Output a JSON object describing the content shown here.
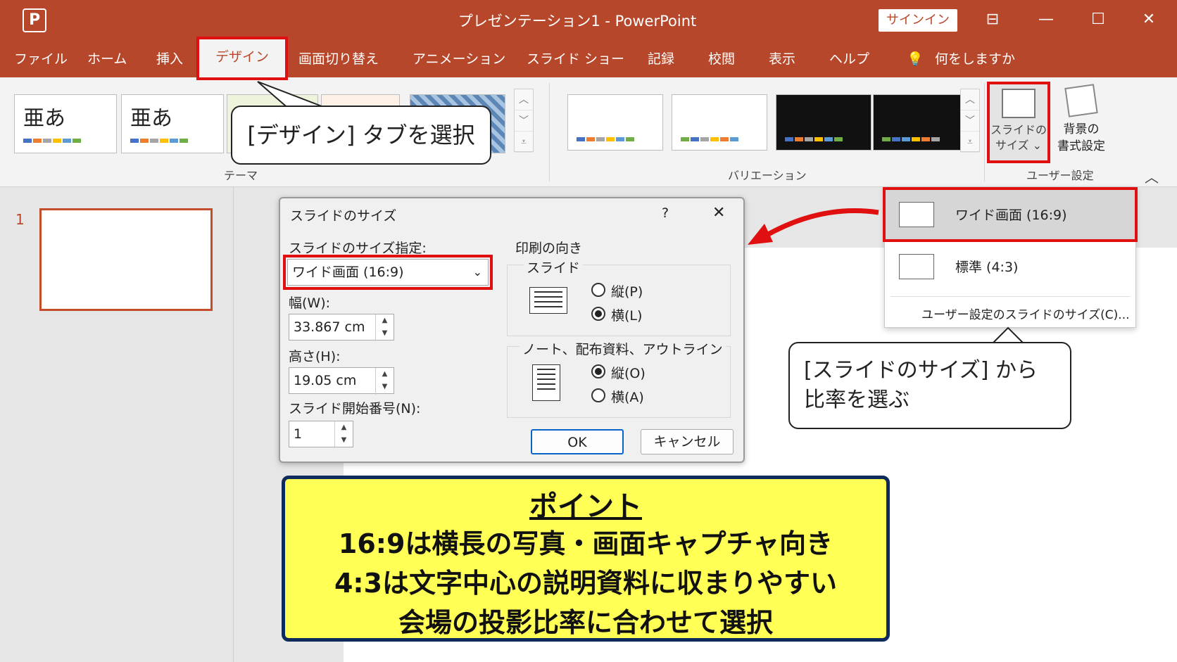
{
  "app": {
    "logo": "P",
    "title": "プレゼンテーション1 - PowerPoint",
    "signin": "サインイン"
  },
  "menu": [
    "ファイル",
    "ホーム",
    "挿入",
    "デザイン",
    "画面切り替え",
    "アニメーション",
    "スライド ショー",
    "記録",
    "校閲",
    "表示",
    "ヘルプ"
  ],
  "search_label": "何をしますか",
  "ribbon": {
    "theme_text": "亜あ",
    "themes_label": "テーマ",
    "variations_label": "バリエーション",
    "slide_size_label_1": "スライドの",
    "slide_size_label_2": "サイズ ⌄",
    "bg_format_label_1": "背景の",
    "bg_format_label_2": "書式設定",
    "user_settings_label": "ユーザー設定"
  },
  "thumbnail": {
    "number": "1"
  },
  "dialog": {
    "title": "スライドのサイズ",
    "help": "?",
    "close": "✕",
    "size_label": "スライドのサイズ指定:",
    "size_value": "ワイド画面 (16:9)",
    "width_label": "幅(W):",
    "width_value": "33.867 cm",
    "height_label": "高さ(H):",
    "height_value": "19.05 cm",
    "start_label": "スライド開始番号(N):",
    "start_value": "1",
    "orientation_label": "印刷の向き",
    "slides_label": "スライド",
    "portrait_p": "縦(P)",
    "landscape_l": "横(L)",
    "notes_label": "ノート、配布資料、アウトライン",
    "portrait_o": "縦(O)",
    "landscape_a": "横(A)",
    "ok": "OK",
    "cancel": "キャンセル"
  },
  "dropdown": {
    "wide": "ワイド画面 (16:9)",
    "standard": "標準 (4:3)",
    "custom": "ユーザー設定のスライドのサイズ(C)..."
  },
  "callouts": {
    "design_tab": "[デザイン] タブを選択",
    "size_line1": "[スライドのサイズ] から",
    "size_line2": "比率を選ぶ"
  },
  "point": {
    "title": "ポイント",
    "line1": "16:9は横長の写真・画面キャプチャ向き",
    "line2": "4:3は文字中心の説明資料に収まりやすい",
    "line3": "会場の投影比率に合わせて選択"
  },
  "colors": {
    "accent": "#b7472a",
    "highlight": "#e01010",
    "point_bg": "#ffff55",
    "point_border": "#0f2a5c"
  }
}
